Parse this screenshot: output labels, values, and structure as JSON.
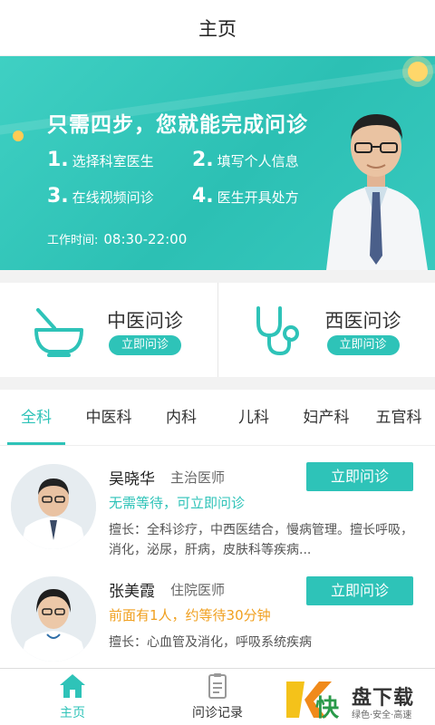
{
  "header": {
    "title": "主页"
  },
  "banner": {
    "headline": "只需四步，您就能完成问诊",
    "steps": [
      {
        "num": "1.",
        "text": "选择科室医生"
      },
      {
        "num": "2.",
        "text": "填写个人信息"
      },
      {
        "num": "3.",
        "text": "在线视频问诊"
      },
      {
        "num": "4.",
        "text": "医生开具处方"
      }
    ],
    "hours_label": "工作时间:",
    "hours_value": "08:30-22:00"
  },
  "consult": {
    "tcm": {
      "name": "中医问诊",
      "button": "立即问诊"
    },
    "western": {
      "name": "西医问诊",
      "button": "立即问诊"
    }
  },
  "tabs": [
    "全科",
    "中医科",
    "内科",
    "儿科",
    "妇产科",
    "五官科"
  ],
  "active_tab": "全科",
  "doctors": [
    {
      "name": "吴晓华",
      "title": "主治医师",
      "status": "无需等待，可立即问诊",
      "status_color": "#2ec3b8",
      "desc": "擅长：全科诊疗，中西医结合，慢病管理。擅长呼吸，消化，泌尿，肝病，皮肤科等疾病...",
      "button": "立即问诊"
    },
    {
      "name": "张美霞",
      "title": "住院医师",
      "status": "前面有1人，约等待30分钟",
      "status_color": "#f0a020",
      "desc": "擅长：心血管及消化，呼吸系统疾病",
      "button": "立即问诊"
    }
  ],
  "bottom_nav": {
    "home": "主页",
    "records": "问诊记录"
  },
  "watermark": {
    "text": "盘下载",
    "sub": "绿色·安全·高速",
    "logo_char": "快"
  },
  "colors": {
    "accent": "#2ec3b8",
    "warning": "#f0a020"
  }
}
